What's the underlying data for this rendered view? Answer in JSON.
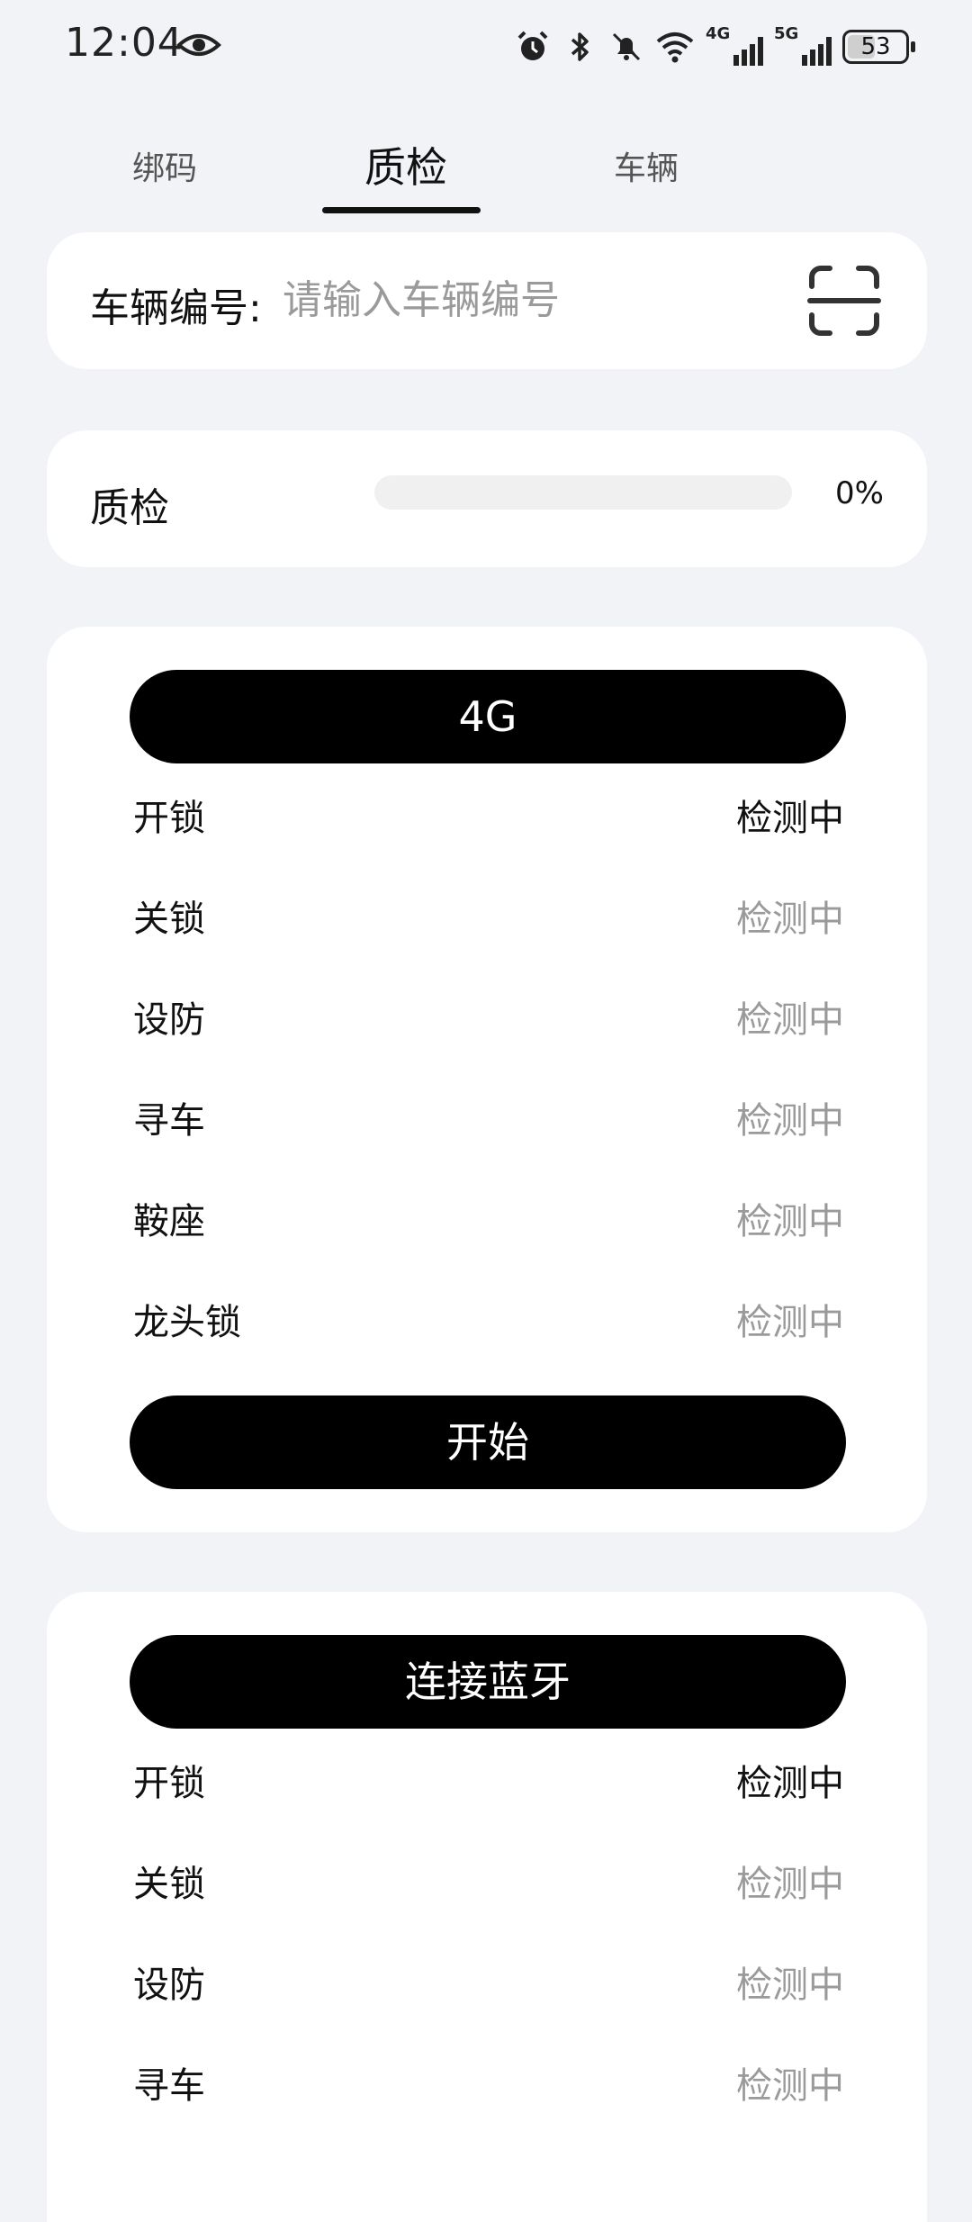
{
  "status_bar": {
    "time": "12:04",
    "icons": [
      "eye-icon",
      "alarm-icon",
      "bluetooth-icon",
      "bell-muted-icon",
      "wifi-icon"
    ],
    "network1": "4G",
    "network2": "5G",
    "battery": "53",
    "battery_level": 0.53
  },
  "tabs": [
    {
      "label": "绑码",
      "active": false
    },
    {
      "label": "质检",
      "active": true
    },
    {
      "label": "车辆",
      "active": false
    }
  ],
  "vehicle": {
    "label": "车辆编号:",
    "placeholder": "请输入车辆编号",
    "value": "",
    "scan_icon": "scan-icon"
  },
  "progress": {
    "label": "质检",
    "value": 0,
    "percent_text": "0%"
  },
  "section_4g": {
    "header": "4G",
    "items": [
      {
        "name": "开锁",
        "status": "检测中",
        "active": true
      },
      {
        "name": "关锁",
        "status": "检测中",
        "active": false
      },
      {
        "name": "设防",
        "status": "检测中",
        "active": false
      },
      {
        "name": "寻车",
        "status": "检测中",
        "active": false
      },
      {
        "name": "鞍座",
        "status": "检测中",
        "active": false
      },
      {
        "name": "龙头锁",
        "status": "检测中",
        "active": false
      }
    ],
    "start_label": "开始"
  },
  "section_bt": {
    "header": "连接蓝牙",
    "items": [
      {
        "name": "开锁",
        "status": "检测中",
        "active": true
      },
      {
        "name": "关锁",
        "status": "检测中",
        "active": false
      },
      {
        "name": "设防",
        "status": "检测中",
        "active": false
      },
      {
        "name": "寻车",
        "status": "检测中",
        "active": false
      }
    ]
  },
  "colors": {
    "background": "#f1f3f7",
    "card": "#ffffff",
    "accent": "#000000",
    "muted_text": "#9a9a9a"
  }
}
